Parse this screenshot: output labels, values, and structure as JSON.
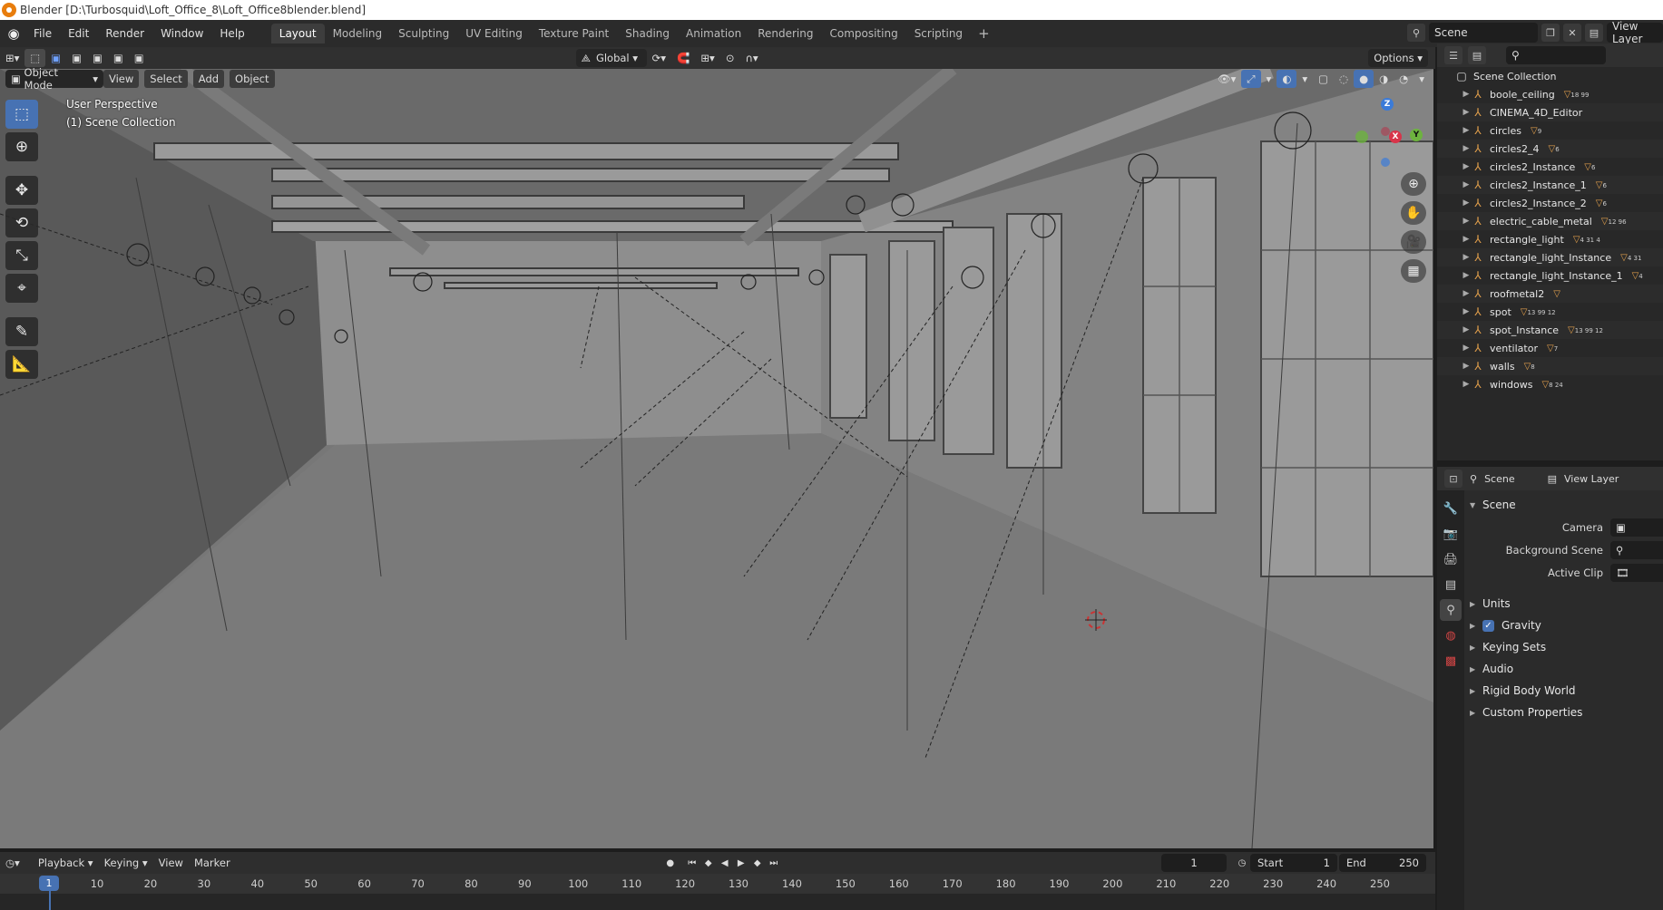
{
  "window": {
    "title": "Blender [D:\\Turbosquid\\Loft_Office_8\\Loft_Office8blender.blend]"
  },
  "menu": [
    "File",
    "Edit",
    "Render",
    "Window",
    "Help"
  ],
  "workspaces": [
    "Layout",
    "Modeling",
    "Sculpting",
    "UV Editing",
    "Texture Paint",
    "Shading",
    "Animation",
    "Rendering",
    "Compositing",
    "Scripting"
  ],
  "active_workspace": "Layout",
  "scene_field": "Scene",
  "view_layer_field": "View Layer",
  "viewport": {
    "mode": "Object Mode",
    "menus": [
      "View",
      "Select",
      "Add",
      "Object"
    ],
    "transform_orientation": "Global",
    "options_label": "Options",
    "overlay_title": "User Perspective",
    "overlay_collection": "(1) Scene Collection"
  },
  "gizmo_axes": {
    "z": "Z",
    "y": "Y",
    "x": "X"
  },
  "toolbar_icons": [
    "select-box-icon",
    "cursor-icon",
    "move-icon",
    "rotate-icon",
    "scale-icon",
    "transform-icon",
    "annotate-icon",
    "measure-icon"
  ],
  "outliner": {
    "root": "Scene Collection",
    "items": [
      {
        "name": "boole_ceiling",
        "extra": "▽",
        "sub": "18 99"
      },
      {
        "name": "CINEMA_4D_Editor",
        "extra": "",
        "sub": ""
      },
      {
        "name": "circles",
        "extra": "▽",
        "sub": "9"
      },
      {
        "name": "circles2_4",
        "extra": "▽",
        "sub": "6"
      },
      {
        "name": "circles2_Instance",
        "extra": "▽",
        "sub": "6"
      },
      {
        "name": "circles2_Instance_1",
        "extra": "▽",
        "sub": "6"
      },
      {
        "name": "circles2_Instance_2",
        "extra": "▽",
        "sub": "6"
      },
      {
        "name": "electric_cable_metal",
        "extra": "▽",
        "sub": "12 96"
      },
      {
        "name": "rectangle_light",
        "extra": "▽",
        "sub": "4 31 4"
      },
      {
        "name": "rectangle_light_Instance",
        "extra": "▽",
        "sub": "4 31"
      },
      {
        "name": "rectangle_light_Instance_1",
        "extra": "▽",
        "sub": "4"
      },
      {
        "name": "roofmetal2",
        "extra": "▽",
        "sub": ""
      },
      {
        "name": "spot",
        "extra": "▽",
        "sub": "13 99 12"
      },
      {
        "name": "spot_Instance",
        "extra": "▽",
        "sub": "13 99 12"
      },
      {
        "name": "ventilator",
        "extra": "▽",
        "sub": "7"
      },
      {
        "name": "walls",
        "extra": "▽",
        "sub": "8"
      },
      {
        "name": "windows",
        "extra": "▽",
        "sub": "8 24"
      }
    ]
  },
  "properties": {
    "header_scene": "Scene",
    "header_view_layer": "View Layer",
    "panel_title": "Scene",
    "camera_label": "Camera",
    "background_scene_label": "Background Scene",
    "active_clip_label": "Active Clip",
    "panels": [
      "Units",
      "Gravity",
      "Keying Sets",
      "Audio",
      "Rigid Body World",
      "Custom Properties"
    ],
    "gravity_checked": true
  },
  "timeline": {
    "menus": [
      "Playback",
      "Keying",
      "View",
      "Marker"
    ],
    "current_frame": "1",
    "start_label": "Start",
    "start_value": "1",
    "end_label": "End",
    "end_value": "250",
    "ticks": [
      "10",
      "20",
      "30",
      "40",
      "50",
      "60",
      "70",
      "80",
      "90",
      "100",
      "110",
      "120",
      "130",
      "140",
      "150",
      "160",
      "170",
      "180",
      "190",
      "200",
      "210",
      "220",
      "230",
      "240",
      "250"
    ],
    "frame_marker": "1"
  }
}
